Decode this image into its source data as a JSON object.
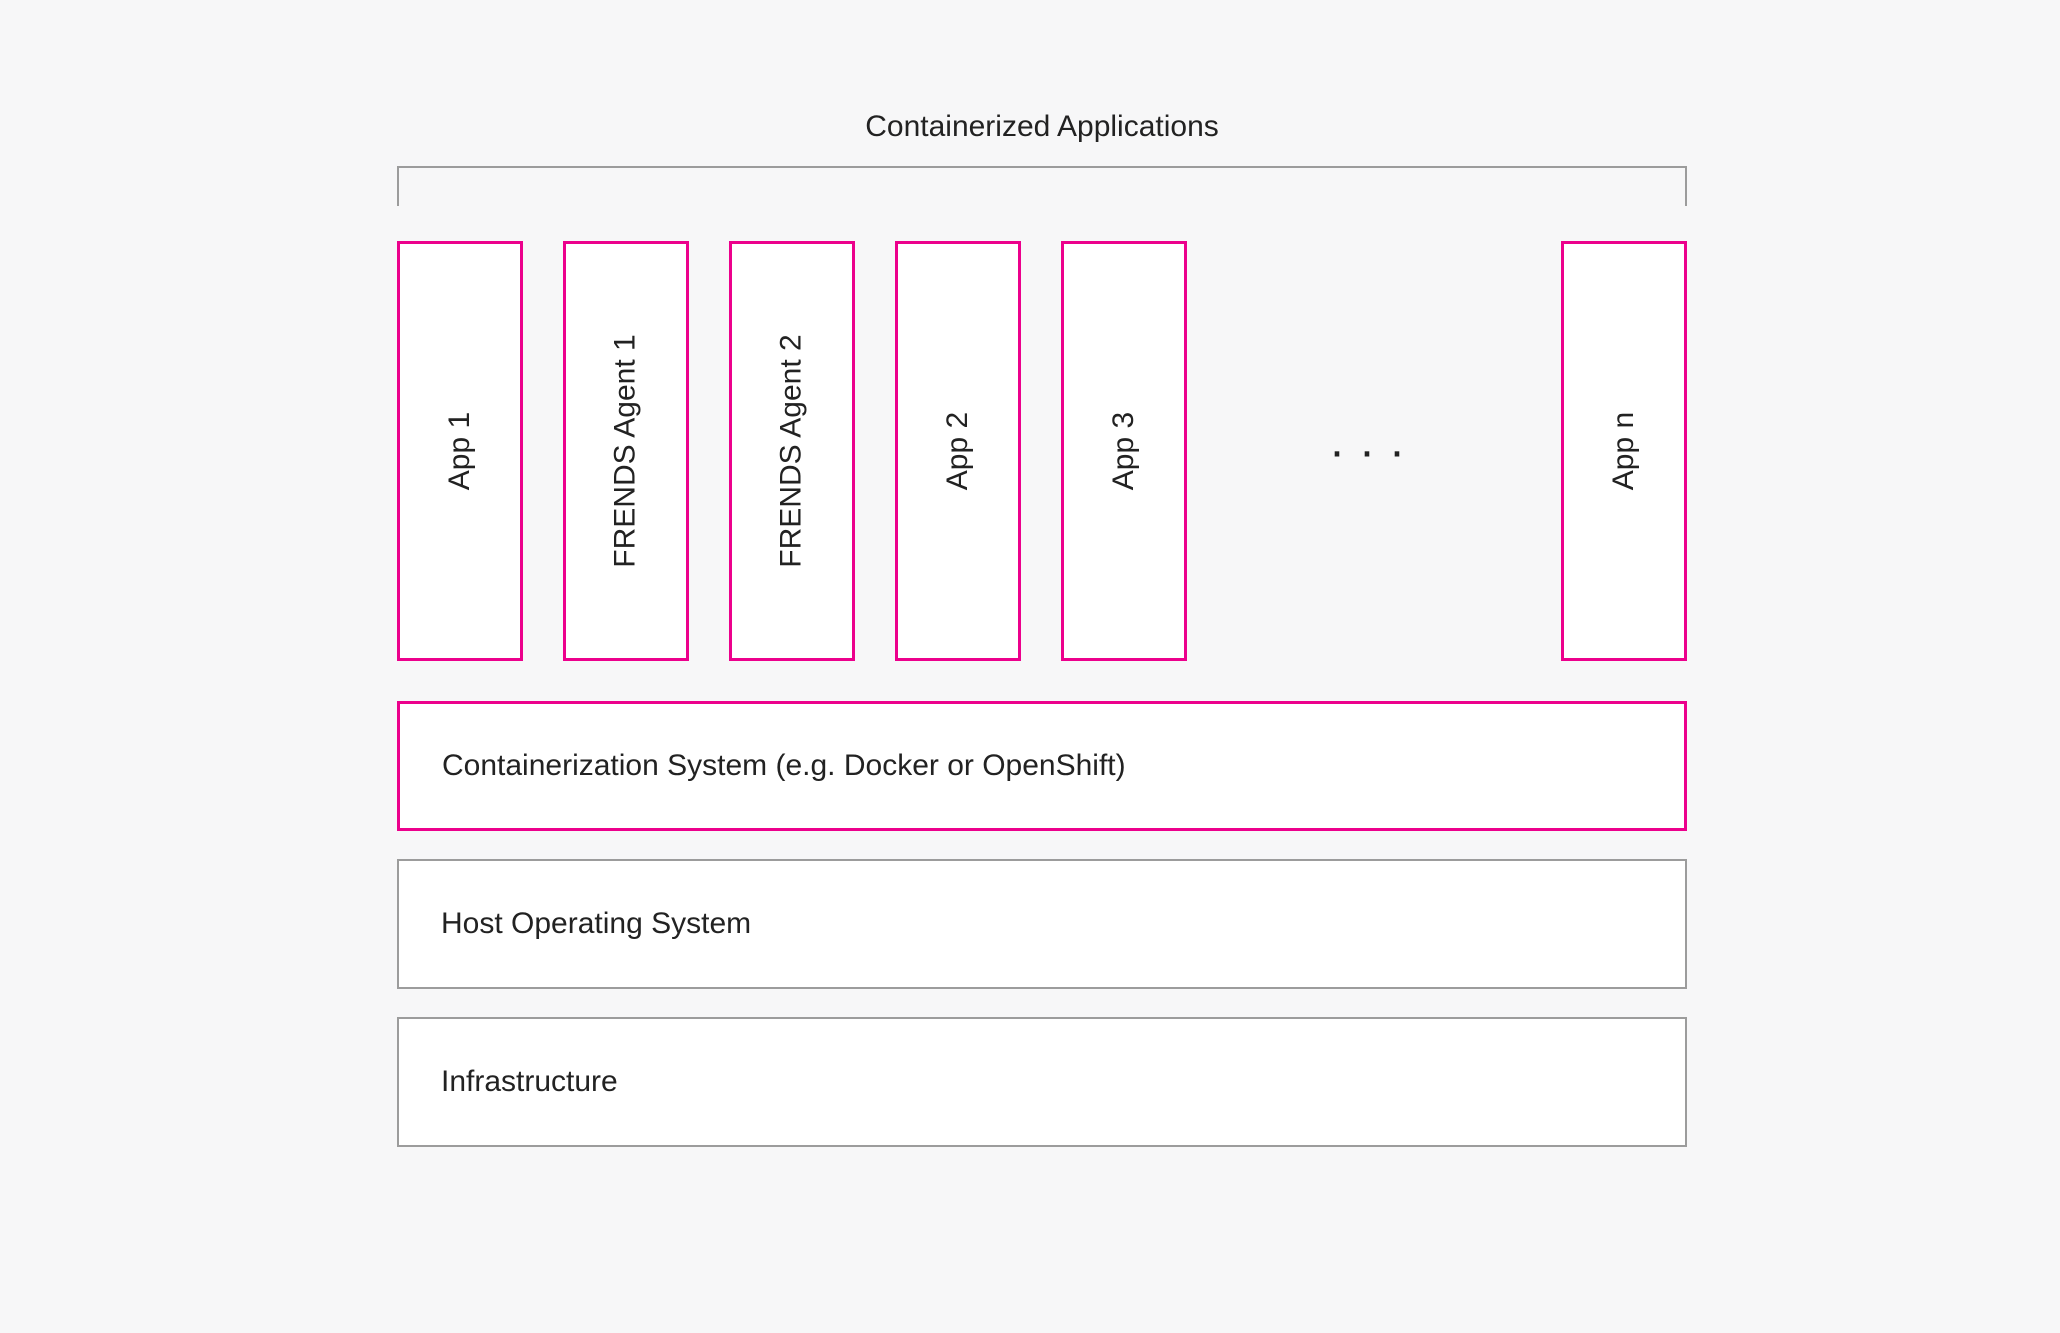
{
  "title": "Containerized Applications",
  "apps": {
    "app1": "App 1",
    "agent1": "FRENDS Agent 1",
    "agent2": "FRENDS Agent 2",
    "app2": "App 2",
    "app3": "App 3",
    "appn": "App n"
  },
  "ellipsis": "···",
  "layers": {
    "container_system": "Containerization System (e.g. Docker or OpenShift)",
    "host_os": "Host Operating System",
    "infrastructure": "Infrastructure"
  },
  "colors": {
    "accent": "#ec008c",
    "neutral_border": "#9c9c9c",
    "background": "#f7f7f8"
  }
}
